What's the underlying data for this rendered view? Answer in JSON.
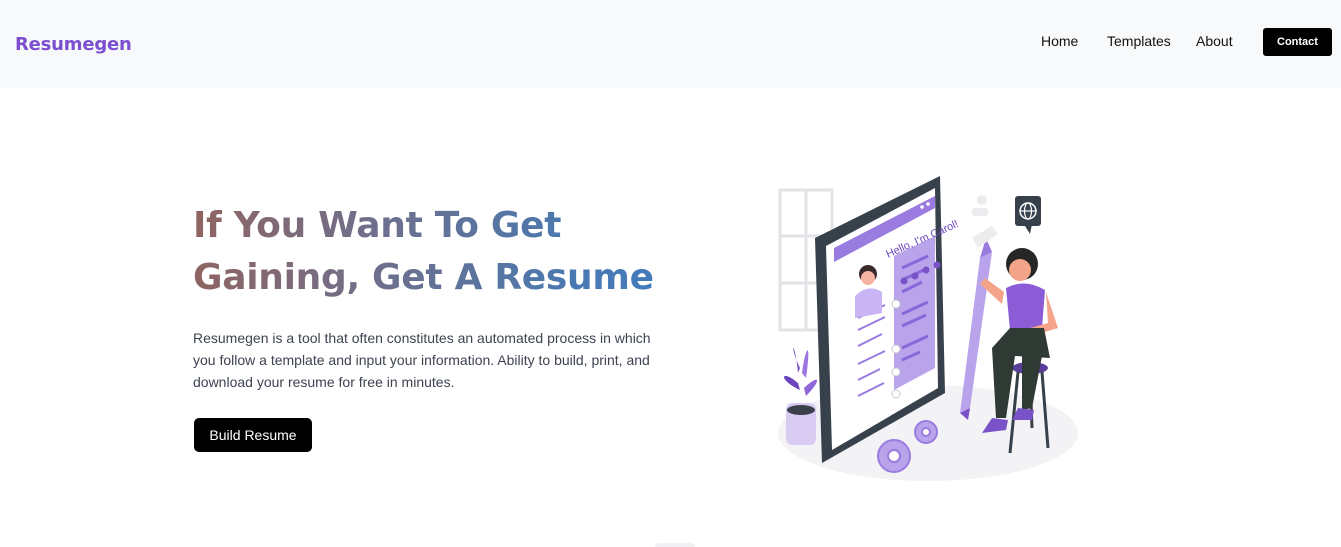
{
  "brand": {
    "name": "Resumegen"
  },
  "nav": {
    "home": "Home",
    "templates": "Templates",
    "about": "About",
    "contact": "Contact"
  },
  "hero": {
    "title_line1": "If You Want To Get",
    "title_line2": "Gaining, Get A Resume",
    "description": "Resumegen is a tool that often constitutes an automated process in which you follow a template and input your information. Ability to build, print, and download your resume for free in minutes.",
    "cta": "Build Resume"
  },
  "illustration": {
    "greeting": "Hello, I'm Carol!",
    "icons": [
      "globe-icon",
      "gear-icon",
      "plant-icon",
      "pencil-icon"
    ]
  },
  "colors": {
    "brand": "#7b4fd0",
    "accent_purple": "#9a7be0",
    "button": "#000000",
    "nav_bg": "#f7f9fb"
  }
}
